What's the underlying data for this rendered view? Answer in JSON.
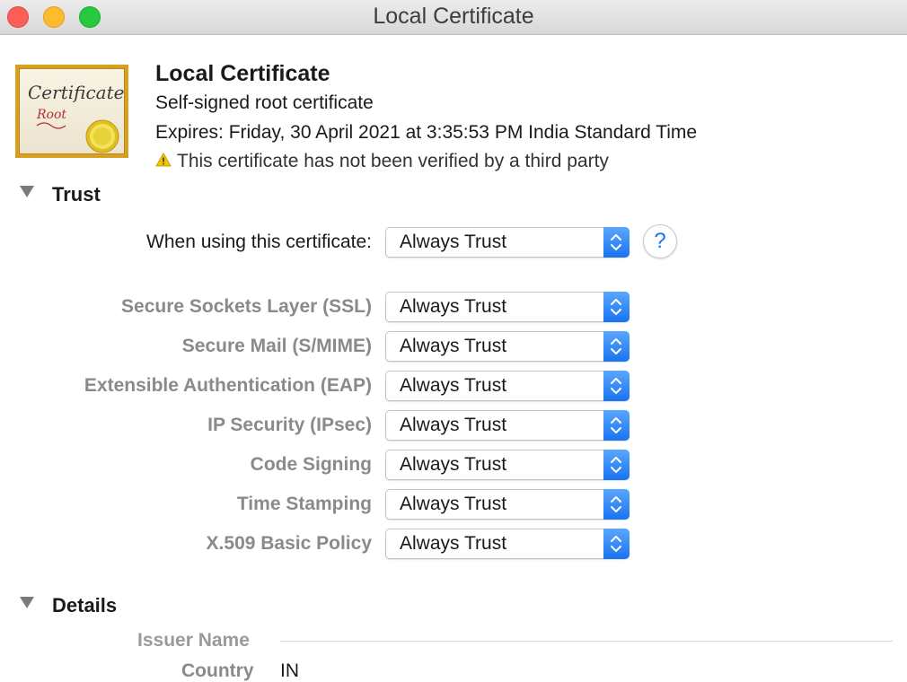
{
  "window": {
    "title": "Local Certificate"
  },
  "header": {
    "name": "Local Certificate",
    "subtitle": "Self-signed root certificate",
    "expires": "Expires: Friday, 30 April 2021 at 3:35:53 PM India Standard Time",
    "warning": "This certificate has not been verified by a third party",
    "icon": {
      "title": "Certificate",
      "subtitle": "Root"
    }
  },
  "trust": {
    "section_label": "Trust",
    "primary": {
      "label": "When using this certificate:",
      "value": "Always Trust"
    },
    "help_label": "?",
    "rows": [
      {
        "label": "Secure Sockets Layer (SSL)",
        "value": "Always Trust"
      },
      {
        "label": "Secure Mail (S/MIME)",
        "value": "Always Trust"
      },
      {
        "label": "Extensible Authentication (EAP)",
        "value": "Always Trust"
      },
      {
        "label": "IP Security (IPsec)",
        "value": "Always Trust"
      },
      {
        "label": "Code Signing",
        "value": "Always Trust"
      },
      {
        "label": "Time Stamping",
        "value": "Always Trust"
      },
      {
        "label": "X.509 Basic Policy",
        "value": "Always Trust"
      }
    ]
  },
  "details": {
    "section_label": "Details",
    "issuer_label": "Issuer Name",
    "country_label": "Country",
    "country_value": "IN"
  },
  "colors": {
    "accent": "#1a73f0",
    "close": "#fc5f57",
    "minimize": "#fdbc2e",
    "zoom": "#28c840",
    "warning": "#f5c400"
  }
}
